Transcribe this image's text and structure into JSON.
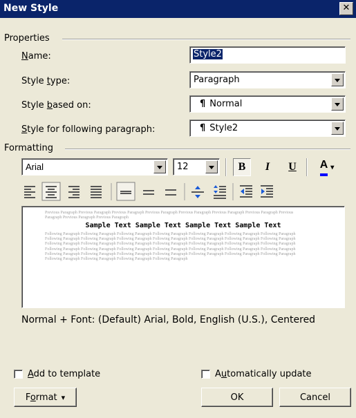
{
  "dialog": {
    "title": "New Style",
    "close_glyph": "✕"
  },
  "properties": {
    "group_label": "Properties",
    "name_label_pre": "",
    "name_label_ul": "N",
    "name_label_post": "ame:",
    "name_value": "Style2",
    "style_type_pre": "Style ",
    "style_type_ul": "t",
    "style_type_post": "ype:",
    "style_type_value": "Paragraph",
    "based_on_pre": "Style ",
    "based_on_ul": "b",
    "based_on_post": "ased on:",
    "based_on_value": "Normal",
    "following_pre": "",
    "following_ul": "S",
    "following_post": "tyle for following paragraph:",
    "following_value": "Style2",
    "pilcrow": "¶"
  },
  "formatting": {
    "group_label": "Formatting",
    "font": "Arial",
    "size": "12",
    "bold": "B",
    "italic": "I",
    "underline": "U",
    "font_color_letter": "A",
    "font_color": "#0000ff"
  },
  "preview": {
    "previous_text": "Previous Paragraph Previous Paragraph Previous Paragraph Previous Paragraph Previous Paragraph Previous Paragraph Previous Paragraph Previous Paragraph Previous Paragraph Previous Paragraph",
    "sample_text": "Sample Text Sample Text Sample Text Sample Text",
    "following_text": "Following Paragraph Following Paragraph Following Paragraph Following Paragraph Following Paragraph Following Paragraph Following Paragraph Following Paragraph Following Paragraph Following Paragraph Following Paragraph Following Paragraph Following Paragraph Following Paragraph Following Paragraph Following Paragraph Following Paragraph Following Paragraph Following Paragraph Following Paragraph Following Paragraph Following Paragraph Following Paragraph Following Paragraph Following Paragraph Following Paragraph Following Paragraph Following Paragraph Following Paragraph Following Paragraph Following Paragraph Following Paragraph Following Paragraph Following Paragraph Following Paragraph Following Paragraph Following Paragraph Following Paragraph Following Paragraph"
  },
  "description": "Normal + Font: (Default) Arial, Bold, English (U.S.), Centered",
  "options": {
    "add_template_pre": "",
    "add_template_ul": "A",
    "add_template_post": "dd to template",
    "auto_update_pre": "A",
    "auto_update_ul": "u",
    "auto_update_post": "tomatically update"
  },
  "buttons": {
    "format_pre": "F",
    "format_ul": "o",
    "format_post": "rmat",
    "format_arrow": "▾",
    "ok": "OK",
    "cancel": "Cancel"
  }
}
